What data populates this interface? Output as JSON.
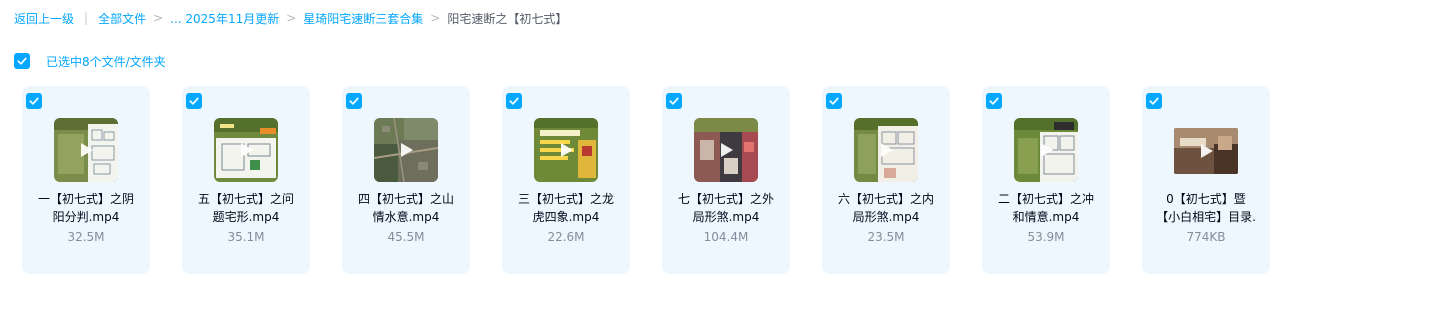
{
  "breadcrumb": {
    "back": "返回上一级",
    "all_files": "全部文件",
    "ellipsis_path": "... 2025年11月更新",
    "parent": "星琦阳宅速断三套合集",
    "current": "阳宅速断之【初七式】"
  },
  "selection": {
    "text": "已选中8个文件/文件夹"
  },
  "files": [
    {
      "name_line1": "一【初七式】之阴",
      "name_line2": "阳分判.mp4",
      "size": "32.5M"
    },
    {
      "name_line1": "五【初七式】之问",
      "name_line2": "题宅形.mp4",
      "size": "35.1M"
    },
    {
      "name_line1": "四【初七式】之山",
      "name_line2": "情水意.mp4",
      "size": "45.5M"
    },
    {
      "name_line1": "三【初七式】之龙",
      "name_line2": "虎四象.mp4",
      "size": "22.6M"
    },
    {
      "name_line1": "七【初七式】之外",
      "name_line2": "局形煞.mp4",
      "size": "104.4M"
    },
    {
      "name_line1": "六【初七式】之内",
      "name_line2": "局形煞.mp4",
      "size": "23.5M"
    },
    {
      "name_line1": "二【初七式】之冲",
      "name_line2": "和情意.mp4",
      "size": "53.9M"
    },
    {
      "name_line1": "0【初七式】暨",
      "name_line2": "【小白相宅】目录.",
      "size": "774KB"
    }
  ],
  "colors": {
    "accent": "#06a7ff",
    "card_bg": "#eef7fe"
  },
  "icons": {
    "checkbox": "checkbox-checked-icon",
    "play": "play-icon"
  }
}
